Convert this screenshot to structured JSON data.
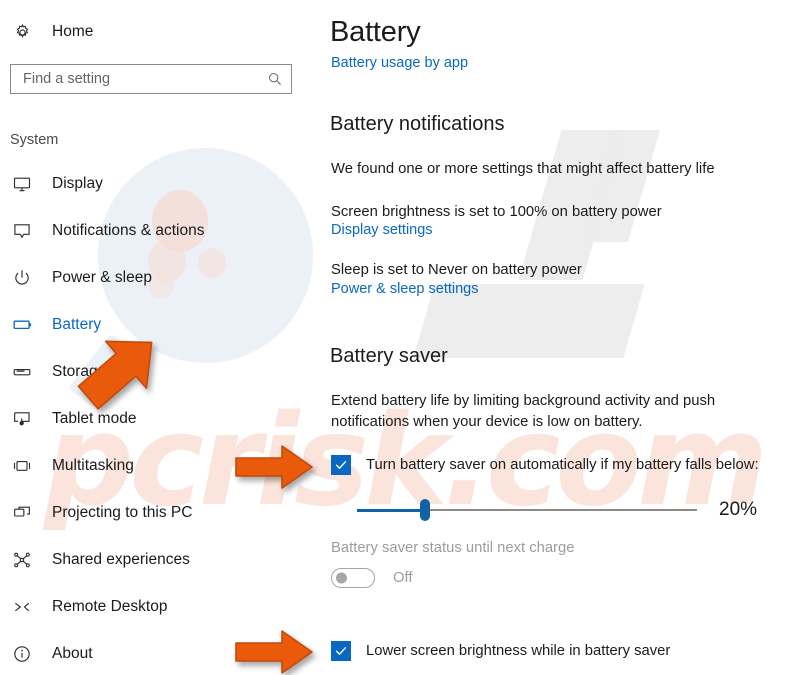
{
  "sidebar": {
    "home_label": "Home",
    "home_icon": "gear-icon",
    "search": {
      "placeholder": "Find a setting",
      "value": "",
      "icon": "search-icon"
    },
    "section_label": "System",
    "selected": "Battery",
    "items": [
      {
        "label": "Display",
        "icon": "monitor-icon"
      },
      {
        "label": "Notifications & actions",
        "icon": "notification-bubble-icon"
      },
      {
        "label": "Power & sleep",
        "icon": "power-icon"
      },
      {
        "label": "Battery",
        "icon": "battery-icon"
      },
      {
        "label": "Storage",
        "icon": "storage-drive-icon"
      },
      {
        "label": "Tablet mode",
        "icon": "tablet-mode-icon"
      },
      {
        "label": "Multitasking",
        "icon": "multitasking-icon"
      },
      {
        "label": "Projecting to this PC",
        "icon": "projecting-icon"
      },
      {
        "label": "Shared experiences",
        "icon": "shared-experiences-icon"
      },
      {
        "label": "Remote Desktop",
        "icon": "remote-desktop-icon"
      },
      {
        "label": "About",
        "icon": "info-icon"
      }
    ]
  },
  "content": {
    "title": "Battery",
    "usage_link": "Battery usage by app",
    "notifications": {
      "heading": "Battery notifications",
      "found_text": "We found one or more settings that might affect battery life",
      "brightness_text": "Screen brightness is set to 100% on battery power",
      "display_link": "Display settings",
      "sleep_text": "Sleep is set to Never on battery power",
      "power_link": "Power & sleep settings"
    },
    "saver": {
      "heading": "Battery saver",
      "description": "Extend battery life by limiting background activity and push notifications when your device is low on battery.",
      "auto_checkbox_label": "Turn battery saver on automatically if my battery falls below:",
      "auto_checkbox_checked": true,
      "slider_value_label": "20%",
      "slider_percent": 20,
      "slider_min": 0,
      "slider_max": 100,
      "status_label": "Battery saver status until next charge",
      "toggle_state": "Off",
      "toggle_on": false,
      "toggle_disabled": true,
      "lower_brightness_label": "Lower screen brightness while in battery saver",
      "lower_brightness_checked": true
    }
  },
  "annotations": {
    "arrow_color": "#ea5a0b",
    "arrows": [
      {
        "name": "arrow-pointing-battery-nav",
        "direction": "up-right"
      },
      {
        "name": "arrow-pointing-auto-checkbox",
        "direction": "right"
      },
      {
        "name": "arrow-pointing-lower-brightness-checkbox",
        "direction": "right"
      }
    ]
  },
  "watermark": {
    "text": "pcrisk.com",
    "glass_icon": "magnifier-watermark-icon"
  },
  "colors": {
    "accent_blue": "#0a68c4",
    "slider_blue": "#1262a8",
    "arrow_orange": "#ea5a0b",
    "disabled_gray": "#9c9c9c",
    "watermark_pink": "#fbe4db",
    "watermark_gray": "#ececec"
  }
}
